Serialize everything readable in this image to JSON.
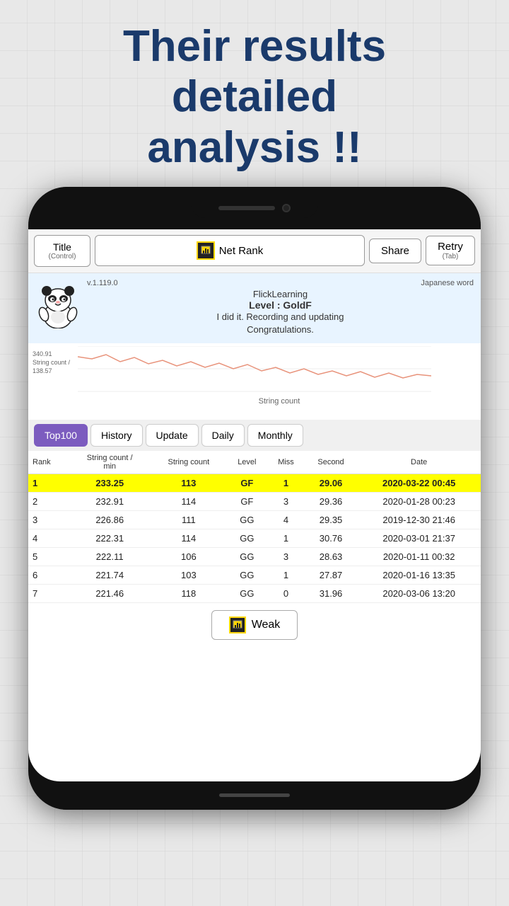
{
  "headline": {
    "line1": "Their results",
    "line2": "detailed",
    "line3": "analysis !!"
  },
  "topbar": {
    "title_label": "Title",
    "title_sub": "(Control)",
    "netrank_label": "Net Rank",
    "share_label": "Share",
    "retry_label": "Retry",
    "retry_sub": "(Tab)"
  },
  "info": {
    "version": "v.1.119.0",
    "app_name": "FlickLearning",
    "category": "Japanese word",
    "level": "Level : GoldF",
    "message1": "I did it. Recording and updating",
    "message2": "Congratulations."
  },
  "chart": {
    "y_top": "340.91",
    "y_label": "String count /",
    "y_bottom": "138.57",
    "x_label": "String count"
  },
  "tabs": [
    {
      "label": "Top100",
      "active": true
    },
    {
      "label": "History",
      "active": false
    },
    {
      "label": "Update",
      "active": false
    },
    {
      "label": "Daily",
      "active": false
    },
    {
      "label": "Monthly",
      "active": false
    }
  ],
  "table": {
    "headers": [
      "Rank",
      "String count /\nmin",
      "String count",
      "Level",
      "Miss",
      "Second",
      "Date"
    ],
    "rows": [
      {
        "rank": 1,
        "string_min": "233.25",
        "string_count": "113",
        "level": "GF",
        "miss": "1",
        "second": "29.06",
        "date": "2020-03-22 00:45",
        "highlight": true
      },
      {
        "rank": 2,
        "string_min": "232.91",
        "string_count": "114",
        "level": "GF",
        "miss": "3",
        "second": "29.36",
        "date": "2020-01-28 00:23",
        "highlight": false
      },
      {
        "rank": 3,
        "string_min": "226.86",
        "string_count": "111",
        "level": "GG",
        "miss": "4",
        "second": "29.35",
        "date": "2019-12-30 21:46",
        "highlight": false
      },
      {
        "rank": 4,
        "string_min": "222.31",
        "string_count": "114",
        "level": "GG",
        "miss": "1",
        "second": "30.76",
        "date": "2020-03-01 21:37",
        "highlight": false
      },
      {
        "rank": 5,
        "string_min": "222.11",
        "string_count": "106",
        "level": "GG",
        "miss": "3",
        "second": "28.63",
        "date": "2020-01-11 00:32",
        "highlight": false
      },
      {
        "rank": 6,
        "string_min": "221.74",
        "string_count": "103",
        "level": "GG",
        "miss": "1",
        "second": "27.87",
        "date": "2020-01-16 13:35",
        "highlight": false
      },
      {
        "rank": 7,
        "string_min": "221.46",
        "string_count": "118",
        "level": "GG",
        "miss": "0",
        "second": "31.96",
        "date": "2020-03-06 13:20",
        "highlight": false
      }
    ]
  },
  "weak_button": "Weak"
}
